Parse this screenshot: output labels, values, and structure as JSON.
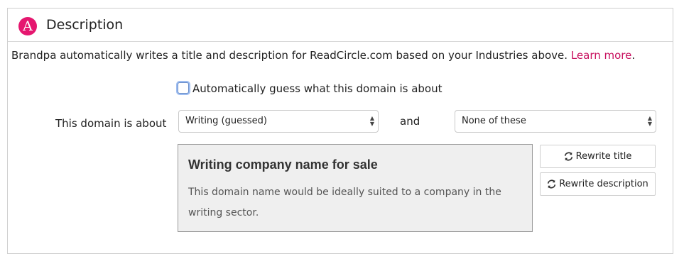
{
  "header": {
    "logo_letter": "A",
    "title": "Description"
  },
  "intro": {
    "text": "Brandpa automatically writes a title and description for ReadCircle.com based on your Industries above.",
    "link": "Learn more",
    "trailing": "."
  },
  "auto_guess": {
    "label": "Automatically guess what this domain is about",
    "checked": false
  },
  "about": {
    "label": "This domain is about",
    "conjunction": "and",
    "select1": "Writing (guessed)",
    "select2": "None of these"
  },
  "preview": {
    "title": "Writing company name for sale",
    "description": "This domain name would be ideally suited to a company in the writing sector."
  },
  "buttons": {
    "rewrite_title": "Rewrite title",
    "rewrite_description": "Rewrite description",
    "icon": "refresh-icon"
  },
  "colors": {
    "brand": "#e5176f",
    "link": "#c8105e"
  }
}
